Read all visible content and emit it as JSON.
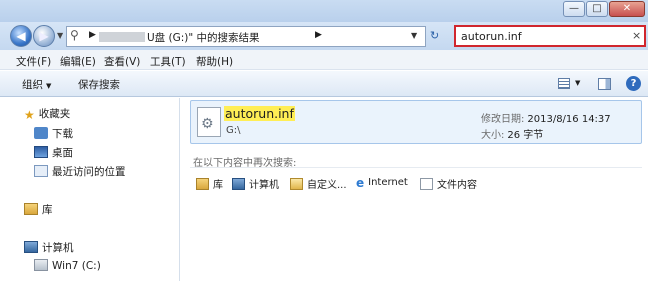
{
  "window": {
    "buttons": {
      "minimize": "—",
      "maximize": "□",
      "close": "✕"
    }
  },
  "address": {
    "crumb_text": "U盘 (G:)\" 中的搜索结果",
    "refresh_icon": "refresh-icon",
    "search_value": "autorun.inf",
    "clear_icon": "×"
  },
  "menu": {
    "items": [
      "文件(F)",
      "编辑(E)",
      "查看(V)",
      "工具(T)",
      "帮助(H)"
    ]
  },
  "toolbar": {
    "organize": "组织",
    "save_search": "保存搜索",
    "help": "?"
  },
  "nav": {
    "favorites": "收藏夹",
    "downloads": "下载",
    "desktop": "桌面",
    "recent": "最近访问的位置",
    "libraries": "库",
    "computer": "计算机",
    "drive_c": "Win7 (C:)"
  },
  "result": {
    "name": "autorun.inf",
    "path": "G:\\",
    "modified_label": "修改日期:",
    "modified_value": "2013/8/16 14:37",
    "size_label": "大小:",
    "size_value": "26 字节"
  },
  "search_again": {
    "heading": "在以下内容中再次搜索:",
    "targets": [
      "库",
      "计算机",
      "自定义...",
      "Internet",
      "文件内容"
    ]
  }
}
